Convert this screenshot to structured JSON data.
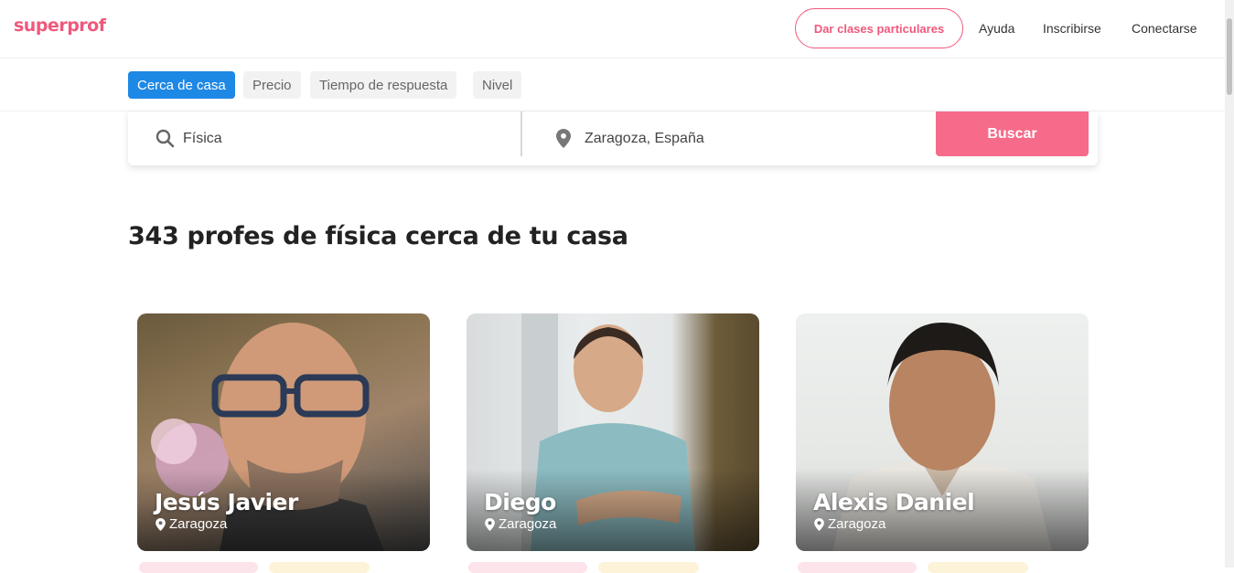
{
  "header": {
    "logo": "superprof",
    "teach_button": "Dar clases particulares",
    "links": [
      "Ayuda",
      "Inscribirse",
      "Conectarse"
    ]
  },
  "filters": [
    "Cerca de casa",
    "Precio",
    "Tiempo de respuesta",
    "Nivel"
  ],
  "active_filter": "Cerca de casa",
  "search": {
    "subject_value": "Física",
    "location_value": "Zaragoza, España",
    "button": "Buscar"
  },
  "results": {
    "title": "343 profes de física cerca de tu casa"
  },
  "tutors": [
    {
      "name": "Jesús Javier",
      "location": "Zaragoza"
    },
    {
      "name": "Diego",
      "location": "Zaragoza"
    },
    {
      "name": "Alexis Daniel",
      "location": "Zaragoza"
    }
  ],
  "colors": {
    "brand": "#f0587c",
    "search_button": "#f66b8a",
    "active_chip": "#1e88e5"
  },
  "icons": [
    "search-icon",
    "location-pin-icon"
  ]
}
